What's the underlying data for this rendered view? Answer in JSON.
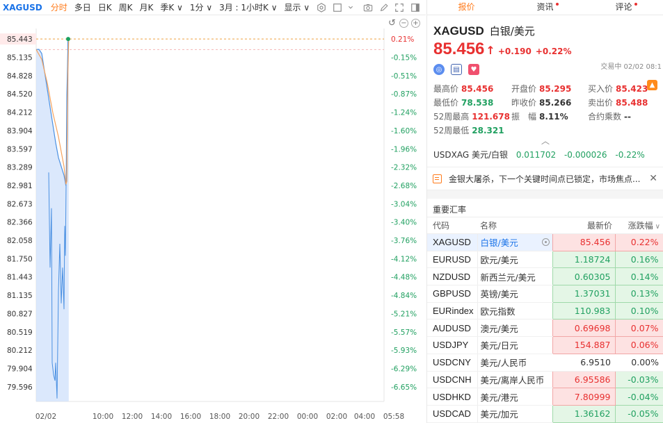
{
  "toolbar": {
    "symbol": "XAGUSD",
    "items": [
      "分时",
      "多日",
      "日K",
      "周K",
      "月K",
      "季K ∨",
      "1分 ∨",
      "3月 : 1小时K ∨",
      "显示 ∨"
    ]
  },
  "chart_data": {
    "type": "line",
    "y_ticks": [
      "85.443",
      "85.135",
      "84.828",
      "84.520",
      "84.212",
      "83.904",
      "83.597",
      "83.289",
      "82.981",
      "82.673",
      "82.366",
      "82.058",
      "81.750",
      "81.443",
      "81.135",
      "80.827",
      "80.519",
      "80.212",
      "79.904",
      "79.596"
    ],
    "pct_ticks": [
      "0.21%",
      "-0.15%",
      "-0.51%",
      "-0.87%",
      "-1.24%",
      "-1.60%",
      "-1.96%",
      "-2.32%",
      "-2.68%",
      "-3.04%",
      "-3.40%",
      "-3.76%",
      "-4.12%",
      "-4.48%",
      "-4.84%",
      "-5.21%",
      "-5.57%",
      "-5.93%",
      "-6.29%",
      "-6.65%"
    ],
    "x_ticks": [
      "02/02",
      "10:00",
      "12:00",
      "14:00",
      "16:00",
      "18:00",
      "20:00",
      "22:00",
      "00:00",
      "02:00",
      "04:00",
      "05:58"
    ],
    "ylim": [
      79.35,
      85.62
    ],
    "prev_close": 85.266,
    "current": 85.443,
    "price_line": [
      [
        0.0,
        85.266
      ],
      [
        1.0,
        85.27
      ],
      [
        2.0,
        85.2
      ],
      [
        3.0,
        84.9
      ],
      [
        4.0,
        84.6
      ],
      [
        5.0,
        84.3
      ],
      [
        6.0,
        84.0
      ],
      [
        7.0,
        83.7
      ],
      [
        8.0,
        83.45
      ],
      [
        9.0,
        83.3
      ],
      [
        10.0,
        83.15
      ],
      [
        10.6,
        83.0
      ],
      [
        11.0,
        83.05
      ],
      [
        11.4,
        85.4
      ],
      [
        11.7,
        85.443
      ]
    ],
    "avg_line": [
      [
        0.0,
        85.266
      ],
      [
        2.0,
        85.1
      ],
      [
        4.0,
        84.7
      ],
      [
        6.0,
        84.2
      ],
      [
        8.0,
        83.8
      ],
      [
        10.0,
        83.3
      ],
      [
        10.7,
        83.0
      ],
      [
        11.0,
        83.05
      ],
      [
        11.4,
        84.9
      ],
      [
        11.7,
        85.443
      ]
    ],
    "x_range_minutes": [
      0,
      120
    ]
  },
  "panel": {
    "tabs": [
      {
        "label": "报价"
      },
      {
        "label": "资讯"
      },
      {
        "label": "评论"
      }
    ],
    "code": "XAGUSD",
    "name": "白银/美元",
    "price": "85.456",
    "change": "+0.190",
    "change_pct": "+0.22%",
    "status": "交易中 02/02 08:1",
    "stats": [
      {
        "k": "最高价",
        "v": "85.456",
        "c": "red"
      },
      {
        "k": "开盘价",
        "v": "85.295",
        "c": "red"
      },
      {
        "k": "买入价",
        "v": "85.423",
        "c": "red"
      },
      {
        "k": "最低价",
        "v": "78.538",
        "c": "green"
      },
      {
        "k": "昨收价",
        "v": "85.266",
        "c": "dark"
      },
      {
        "k": "卖出价",
        "v": "85.488",
        "c": "red"
      },
      {
        "k": "52周最高",
        "v": "121.678",
        "c": "red"
      },
      {
        "k": "振　幅",
        "v": "8.11%",
        "c": "dark"
      },
      {
        "k": "合约乘数",
        "v": "--",
        "c": "dark"
      },
      {
        "k": "52周最低",
        "v": "28.321",
        "c": "green"
      }
    ],
    "usdxag": {
      "label": "USDXAG 美元/白银",
      "price": "0.011702",
      "change": "-0.000026",
      "pct": "-0.22%"
    },
    "news": "金银大屠杀，下一个关键时间点已锁定，市场焦点...",
    "rates_title": "重要汇率",
    "headers": {
      "code": "代码",
      "name": "名称",
      "price": "最新价",
      "pct": "涨跌幅"
    },
    "rows": [
      {
        "code": "XAGUSD",
        "name": "白银/美元",
        "price": "85.456",
        "pct": "0.22%",
        "dir": "up",
        "sel": true
      },
      {
        "code": "EURUSD",
        "name": "欧元/美元",
        "price": "1.18724",
        "pct": "0.16%",
        "pdir": "up",
        "dir": "dn"
      },
      {
        "code": "NZDUSD",
        "name": "新西兰元/美元",
        "price": "0.60305",
        "pct": "0.14%",
        "dir": "dn"
      },
      {
        "code": "GBPUSD",
        "name": "英镑/美元",
        "price": "1.37031",
        "pct": "0.13%",
        "dir": "dn"
      },
      {
        "code": "EURindex",
        "name": "欧元指数",
        "price": "110.983",
        "pct": "0.10%",
        "dir": "dn"
      },
      {
        "code": "AUDUSD",
        "name": "澳元/美元",
        "price": "0.69698",
        "pct": "0.07%",
        "dir": "up"
      },
      {
        "code": "USDJPY",
        "name": "美元/日元",
        "price": "154.887",
        "pct": "0.06%",
        "dir": "up"
      },
      {
        "code": "USDCNY",
        "name": "美元/人民币",
        "price": "6.9510",
        "pct": "0.00%",
        "dir": "flat"
      },
      {
        "code": "USDCNH",
        "name": "美元/离岸人民币",
        "price": "6.95586",
        "pct": "-0.03%",
        "dir": "up"
      },
      {
        "code": "USDHKD",
        "name": "美元/港元",
        "price": "7.80999",
        "pct": "-0.04%",
        "dir": "up"
      },
      {
        "code": "USDCAD",
        "name": "美元/加元",
        "price": "1.36162",
        "pct": "-0.05%",
        "dir": "dn"
      }
    ],
    "colors": {
      "up": "#e83030",
      "down": "#20a060",
      "accent": "#ff7a1a",
      "link": "#1a73e8"
    }
  }
}
